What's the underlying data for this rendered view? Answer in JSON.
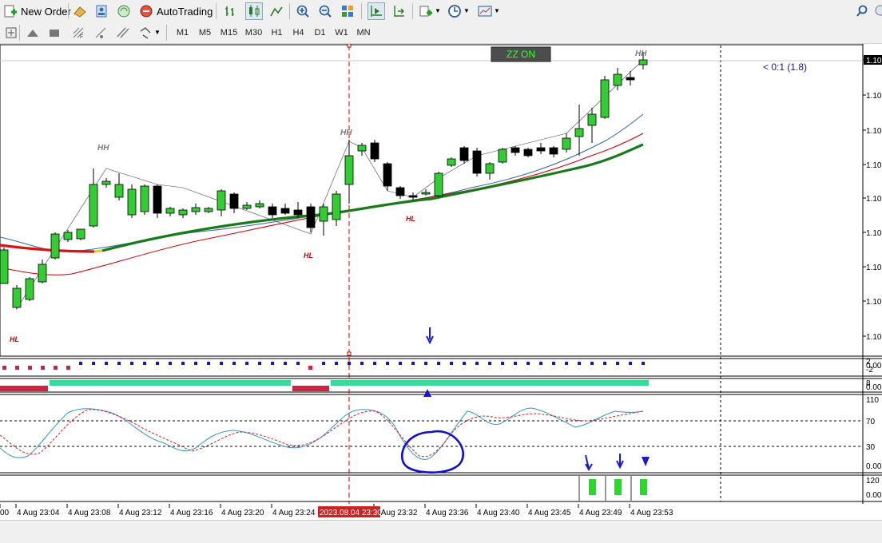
{
  "toolbar": {
    "new_order_label": "New Order",
    "auto_trading_label": "AutoTrading",
    "timeframes": [
      "M1",
      "M5",
      "M15",
      "M30",
      "H1",
      "H4",
      "D1",
      "W1",
      "MN"
    ]
  },
  "chart": {
    "zz_label": "ZZ ON",
    "ratio_label": "< 0:1 (1.8)",
    "swing_labels": [
      "HH",
      "HH",
      "HH",
      "HL",
      "HL",
      "HL"
    ],
    "price_axis": [
      "1.10",
      "1.100",
      "1.100",
      "1.100",
      "1.100",
      "1.100",
      "1.100",
      "1.100",
      "1.100"
    ],
    "sub1_axis": [
      "2",
      "0.00",
      "-2"
    ],
    "sub2_axis": [
      "8",
      "0.00"
    ],
    "sub3_axis": [
      "110",
      "70",
      "30",
      "0.00"
    ],
    "sub4_axis": [
      "120",
      "0.00"
    ],
    "time_labels": [
      "00",
      "4 Aug 23:04",
      "4 Aug 23:08",
      "4 Aug 23:12",
      "4 Aug 23:16",
      "4 Aug 23:20",
      "4 Aug 23:24",
      "4 Aug 23:32",
      "4 Aug 23:36",
      "4 Aug 23:40",
      "4 Aug 23:45",
      "4 Aug 23:49",
      "4 Aug 23:53"
    ],
    "time_highlight": "2023.08.04 23:30"
  },
  "colors": {
    "bull": "#33cc33",
    "bear": "#000000",
    "ma_green": "#1a7a1a",
    "ma_red": "#cc0000",
    "ma_blue": "#3366aa",
    "zz_badge_bg": "#4d4d4d",
    "zz_badge_text": "#33ff33",
    "hh_color": "#7a7a7a",
    "hl_color": "#cc0000",
    "arrow_blue": "#1a1acc",
    "mint": "#33dd99",
    "crimson": "#cc2244"
  }
}
